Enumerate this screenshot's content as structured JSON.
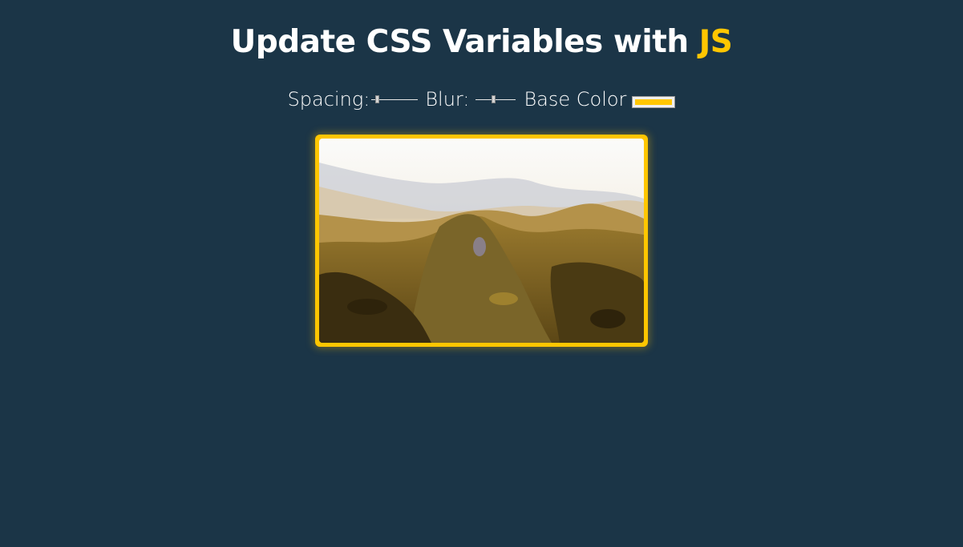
{
  "theme": {
    "background": "#1b3547",
    "accent": "#ffc600"
  },
  "header": {
    "title_prefix": "Update CSS Variables with",
    "title_highlight": "JS"
  },
  "controls": {
    "spacing_label": "Spacing:",
    "spacing_value": 0.1,
    "blur_label": "Blur:",
    "blur_value": 0.45,
    "base_color_label": "Base Color",
    "base_color_value": "#ffc600"
  },
  "image": {
    "subject": "mountain-landscape-photo"
  }
}
